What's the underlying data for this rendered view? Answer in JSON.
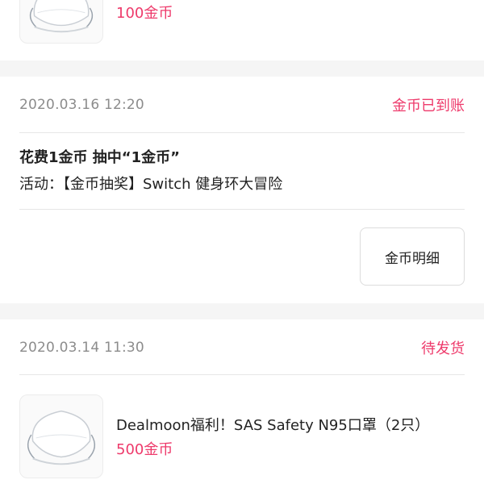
{
  "orders": [
    {
      "price": "100金币",
      "image_icon": "n95-mask-image"
    },
    {
      "date": "2020.03.16",
      "time": "12:20",
      "status": "金币已到账",
      "line1": "花费1金币 抽中“1金币”",
      "line2": "活动：【金币抽奖】Switch 健身环大冒险",
      "button_label": "金币明细"
    },
    {
      "date": "2020.03.14",
      "time": "11:30",
      "status": "待发货",
      "title": "Dealmoon福利！SAS Safety N95口罩（2只）",
      "price": "500金币",
      "image_icon": "n95-mask-image"
    }
  ],
  "colors": {
    "accent": "#ee3a6b",
    "muted_text": "#8c8c8c",
    "background": "#f5f5f5"
  }
}
